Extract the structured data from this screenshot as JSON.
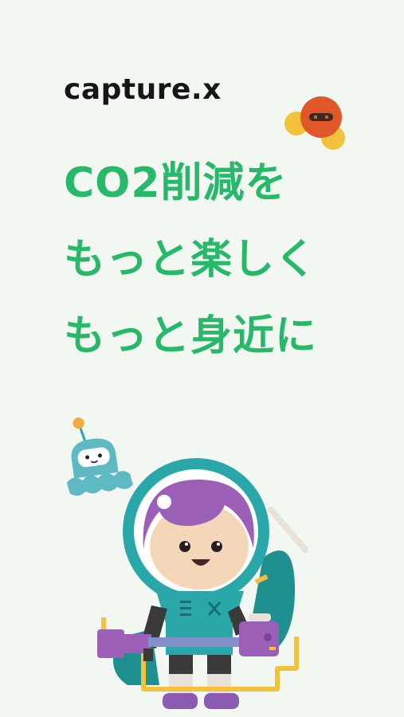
{
  "app": {
    "logo_text": "capture.x"
  },
  "headline": {
    "lines": [
      "CO2削減を",
      "もっと楽しく",
      "もっと身近に"
    ]
  },
  "colors": {
    "background": "#f2f7f2",
    "accent_green": "#28b86a",
    "logo_text": "#161616",
    "astronaut_teal": "#2aa7a8",
    "hair_purple": "#9b5fb8",
    "robot_orange": "#e0572a",
    "yellow": "#f3c23b"
  },
  "icons": [
    "orange-robot-icon",
    "octopus-robot-icon",
    "astronaut-character-illustration"
  ]
}
